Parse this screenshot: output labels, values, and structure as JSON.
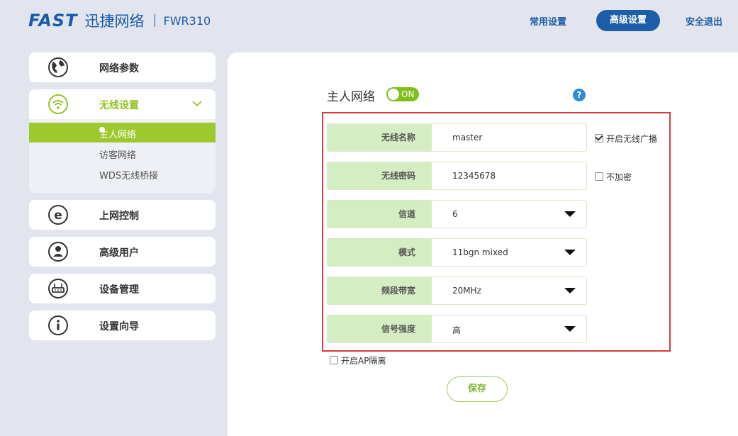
{
  "header": {
    "brand": "FAST",
    "brand_cn": "迅捷网络",
    "model": "FWR310",
    "nav": {
      "common": "常用设置",
      "advanced": "高级设置",
      "logout": "安全退出"
    }
  },
  "sidebar": {
    "items": [
      {
        "label": "网络参数",
        "icon": "globe-icon"
      },
      {
        "label": "无线设置",
        "icon": "wifi-icon",
        "expanded": true,
        "subitems": [
          {
            "label": "主人网络",
            "active": true
          },
          {
            "label": "访客网络"
          },
          {
            "label": "WDS无线桥接"
          }
        ]
      },
      {
        "label": "上网控制",
        "icon": "internet-explorer-icon"
      },
      {
        "label": "高级用户",
        "icon": "user-icon"
      },
      {
        "label": "设备管理",
        "icon": "router-icon"
      },
      {
        "label": "设置向导",
        "icon": "info-icon"
      }
    ]
  },
  "main": {
    "title": "主人网络",
    "toggle": "ON",
    "help": "?",
    "fields": [
      {
        "label": "无线名称",
        "value": "master"
      },
      {
        "label": "无线密码",
        "value": "12345678"
      },
      {
        "label": "信道",
        "value": "6"
      },
      {
        "label": "模式",
        "value": "11bgn mixed"
      },
      {
        "label": "频段带宽",
        "value": "20MHz"
      },
      {
        "label": "信号强度",
        "value": "高"
      }
    ],
    "checkboxes": {
      "broadcast": {
        "label": "开启无线广播",
        "checked": true
      },
      "no_encrypt": {
        "label": "不加密",
        "checked": false
      },
      "ap_isolation": {
        "label": "开启AP隔离",
        "checked": false
      }
    },
    "save": "保存"
  },
  "colors": {
    "brand_blue": "#1a5ca8",
    "accent_green": "#9dc92d",
    "highlight_red": "#d83b3b"
  }
}
